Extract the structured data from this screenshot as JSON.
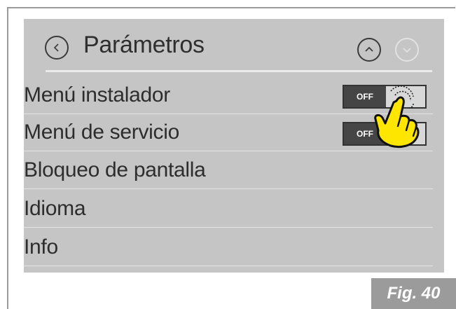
{
  "header": {
    "title": "Parámetros",
    "back_icon": "chevron-left-icon",
    "up_icon": "chevron-up-icon",
    "down_icon": "chevron-down-icon"
  },
  "rows": [
    {
      "label": "Menú instalador",
      "toggle": "OFF"
    },
    {
      "label": "Menú de servicio",
      "toggle": "OFF"
    },
    {
      "label": "Bloqueo de pantalla"
    },
    {
      "label": "Idioma"
    },
    {
      "label": "Info"
    }
  ],
  "figure_caption": "Fig. 40",
  "colors": {
    "screen_bg": "#c5c5c5",
    "toggle_off_bg": "#454545",
    "hand_fill": "#ffe600",
    "caption_bg": "#9b9b9b"
  }
}
